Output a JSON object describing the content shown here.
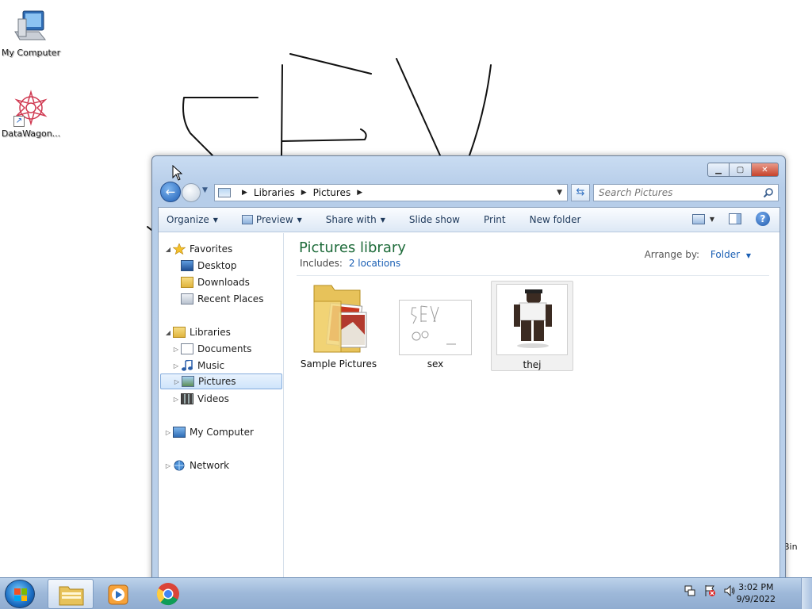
{
  "desktop": {
    "icons": [
      {
        "label": "My Computer",
        "icon": "computer-icon"
      },
      {
        "label": "DataWagon...",
        "icon": "datawagon-icon"
      }
    ],
    "recycle_bin_label": "Bin"
  },
  "explorer": {
    "breadcrumb": [
      "Libraries",
      "Pictures"
    ],
    "search_placeholder": "Search Pictures",
    "toolbar": {
      "organize": "Organize",
      "preview": "Preview",
      "share_with": "Share with",
      "slide_show": "Slide show",
      "print": "Print",
      "new_folder": "New folder"
    },
    "nav": {
      "favorites": "Favorites",
      "desktop": "Desktop",
      "downloads": "Downloads",
      "recent_places": "Recent Places",
      "libraries": "Libraries",
      "documents": "Documents",
      "music": "Music",
      "pictures": "Pictures",
      "videos": "Videos",
      "my_computer": "My Computer",
      "network": "Network"
    },
    "library": {
      "title": "Pictures library",
      "includes_label": "Includes:",
      "locations_link": "2 locations",
      "arrange_label": "Arrange by:",
      "arrange_value": "Folder"
    },
    "items": [
      {
        "name": "Sample Pictures",
        "type": "folder"
      },
      {
        "name": "sex",
        "type": "image"
      },
      {
        "name": "thej",
        "type": "image",
        "selected": true
      }
    ]
  },
  "taskbar": {
    "pinned": [
      "windows-explorer-icon",
      "media-player-icon",
      "chrome-icon"
    ],
    "clock_time": "3:02 PM",
    "clock_date": "9/9/2022"
  }
}
